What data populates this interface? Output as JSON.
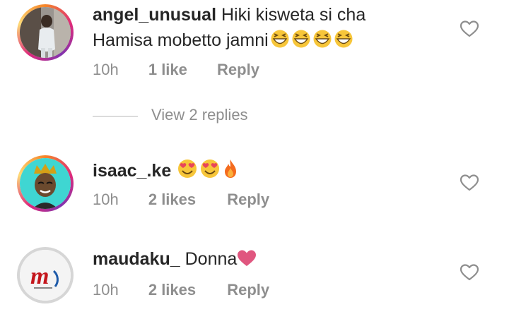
{
  "comments": [
    {
      "username": "angel_unusual",
      "text_line1": "Hiki kisweta si cha",
      "text_line2": "Hamisa mobetto jamni",
      "emojis": [
        "grinning-squinting-face",
        "grinning-squinting-face",
        "grinning-squinting-face",
        "grinning-squinting-face"
      ],
      "time": "10h",
      "likes": "1 like",
      "reply": "Reply",
      "view_replies": "View 2 replies"
    },
    {
      "username": "isaac_.ke",
      "text": "",
      "emojis": [
        "smiling-face-with-heart-eyes",
        "smiling-face-with-heart-eyes",
        "fire"
      ],
      "time": "10h",
      "likes": "2 likes",
      "reply": "Reply"
    },
    {
      "username": "maudaku_",
      "text": "Donna",
      "emojis": [
        "heart-suit"
      ],
      "time": "10h",
      "likes": "2 likes",
      "reply": "Reply"
    }
  ],
  "colors": {
    "text": "#262626",
    "meta": "#8e8e8e",
    "divider": "#dbdbdb",
    "heart_emoji": "#e0567f",
    "ring_start": "#f58529",
    "ring_mid": "#dd2a7b"
  },
  "icons": {
    "like": "heart-outline-icon"
  }
}
